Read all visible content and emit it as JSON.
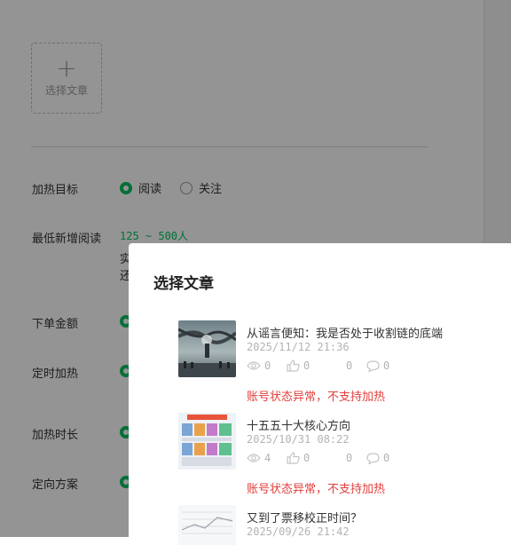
{
  "select_article": {
    "plus": "+",
    "label": "选择文章"
  },
  "form": {
    "target": {
      "label": "加热目标",
      "options": [
        "阅读",
        "关注"
      ],
      "selected": "阅读"
    },
    "min_reads": {
      "label": "最低新增阅读",
      "range": "125 ~ 500人",
      "note_line1": "实",
      "note_line2": "还"
    },
    "amount": {
      "label": "下单金额"
    },
    "schedule": {
      "label": "定时加热"
    },
    "duration": {
      "label": "加热时长"
    },
    "targeting": {
      "label": "定向方案"
    }
  },
  "modal": {
    "title": "选择文章",
    "articles": [
      {
        "title": "从谣言便知：我是否处于收割链的底端",
        "date": "2025/11/12 21:36",
        "views": "0",
        "likes": "0",
        "shares": "0",
        "comments": "0",
        "warning": "账号状态异常，不支持加热"
      },
      {
        "title": "十五五十大核心方向",
        "date": "2025/10/31 08:22",
        "views": "4",
        "likes": "0",
        "shares": "0",
        "comments": "0",
        "warning": "账号状态异常，不支持加热"
      },
      {
        "title": "又到了票移校正时间？",
        "date": "2025/09/26 21:42"
      }
    ]
  },
  "colors": {
    "accent": "#07c160",
    "warning": "#e0403c",
    "muted": "#b3b3b3"
  }
}
